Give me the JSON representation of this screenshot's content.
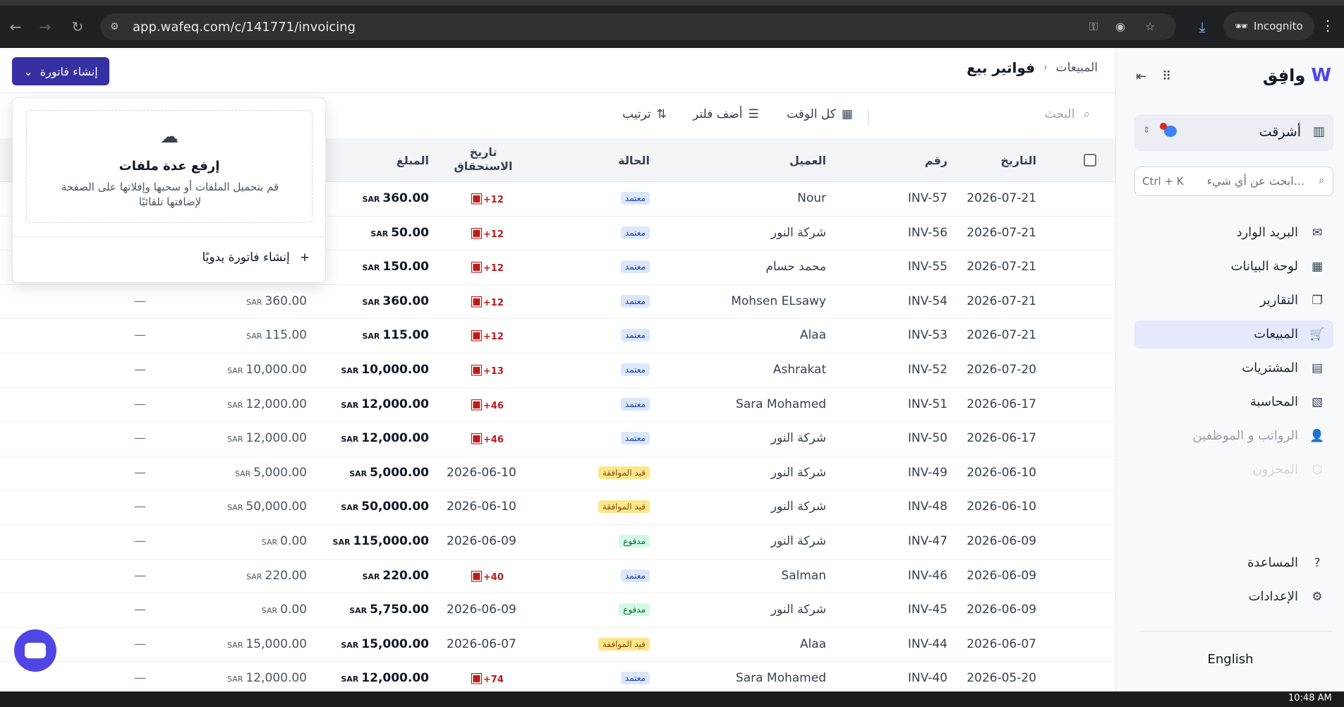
{
  "browser": {
    "url": "app.wafeq.com/c/141771/invoicing",
    "profile_label": "Incognito"
  },
  "sidebar": {
    "logo_text": "وافِق",
    "org_name": "أشرقت",
    "search_placeholder": "ابحث عن أي شيء...",
    "search_shortcut": "Ctrl + K",
    "items": [
      {
        "label": "البريد الوارد",
        "icon": "inbox-icon"
      },
      {
        "label": "لوحة البيانات",
        "icon": "dashboard-icon"
      },
      {
        "label": "التقارير",
        "icon": "reports-icon"
      },
      {
        "label": "المبيعات",
        "icon": "cart-icon"
      },
      {
        "label": "المشتريات",
        "icon": "purchases-icon"
      },
      {
        "label": "المحاسبة",
        "icon": "accounting-icon"
      },
      {
        "label": "الرواتب و الموظفين",
        "icon": "users-icon"
      },
      {
        "label": "المخزون",
        "icon": "box-icon"
      }
    ],
    "bottom_items": [
      {
        "label": "المساعدة",
        "icon": "help-icon"
      },
      {
        "label": "الإعدادات",
        "icon": "gear-icon"
      }
    ],
    "language": "English"
  },
  "header": {
    "breadcrumb_parent": "المبيعات",
    "title": "فواتير بيع",
    "create_button": "إنشاء فاتورة"
  },
  "toolbar": {
    "search_placeholder": "البحث",
    "time_filter": "كل الوقت",
    "add_filter": "أضف فلتر",
    "sort": "ترتيب"
  },
  "popover": {
    "upload_title": "إرفع عدة ملفات",
    "upload_desc": "قم بتحميل الملفات أو سحبها وإفلاتها على الصفحة لإضافتها تلقائيًا",
    "manual_create": "إنشاء فاتورة يدويًا"
  },
  "table": {
    "columns": {
      "date": "التاريخ",
      "number": "رقم",
      "customer": "العميل",
      "status": "الحالة",
      "due_date": "تاريخ الاستحقاق",
      "amount": "المبلغ"
    },
    "currency": "SAR",
    "rows": [
      {
        "date": "2026-07-21",
        "number": "INV-57",
        "customer": "Nour",
        "status": "معتمد",
        "due": "+12",
        "amount": "360.00",
        "balance": "",
        "extra": ""
      },
      {
        "date": "2026-07-21",
        "number": "INV-56",
        "customer": "شركة النور",
        "status": "معتمد",
        "due": "+12",
        "amount": "50.00",
        "balance": "",
        "extra": ""
      },
      {
        "date": "2026-07-21",
        "number": "INV-55",
        "customer": "محمد حسام",
        "status": "معتمد",
        "due": "+12",
        "amount": "150.00",
        "balance": "",
        "extra": ""
      },
      {
        "date": "2026-07-21",
        "number": "INV-54",
        "customer": "Mohsen ELsawy",
        "status": "معتمد",
        "due": "+12",
        "amount": "360.00",
        "balance": "360.00",
        "extra": "—"
      },
      {
        "date": "2026-07-21",
        "number": "INV-53",
        "customer": "Alaa",
        "status": "معتمد",
        "due": "+12",
        "amount": "115.00",
        "balance": "115.00",
        "extra": "—"
      },
      {
        "date": "2026-07-20",
        "number": "INV-52",
        "customer": "Ashrakat",
        "status": "معتمد",
        "due": "+13",
        "amount": "10,000.00",
        "balance": "10,000.00",
        "extra": "—"
      },
      {
        "date": "2026-06-17",
        "number": "INV-51",
        "customer": "Sara Mohamed",
        "status": "معتمد",
        "due": "+46",
        "amount": "12,000.00",
        "balance": "12,000.00",
        "extra": "—"
      },
      {
        "date": "2026-06-17",
        "number": "INV-50",
        "customer": "شركة النور",
        "status": "معتمد",
        "due": "+46",
        "amount": "12,000.00",
        "balance": "12,000.00",
        "extra": "—"
      },
      {
        "date": "2026-06-10",
        "number": "INV-49",
        "customer": "شركة النور",
        "status": "قيد الموافقة",
        "due_text": "2026-06-10",
        "amount": "5,000.00",
        "balance": "5,000.00",
        "extra": "—"
      },
      {
        "date": "2026-06-10",
        "number": "INV-48",
        "customer": "شركة النور",
        "status": "قيد الموافقة",
        "due_text": "2026-06-10",
        "amount": "50,000.00",
        "balance": "50,000.00",
        "extra": "—"
      },
      {
        "date": "2026-06-09",
        "number": "INV-47",
        "customer": "شركة النور",
        "status": "مدفوع",
        "due_text": "2026-06-09",
        "amount": "115,000.00",
        "balance": "0.00",
        "extra": "—"
      },
      {
        "date": "2026-06-09",
        "number": "INV-46",
        "customer": "Salman",
        "status": "معتمد",
        "due": "+40",
        "amount": "220.00",
        "balance": "220.00",
        "extra": "—"
      },
      {
        "date": "2026-06-09",
        "number": "INV-45",
        "customer": "شركة النور",
        "status": "مدفوع",
        "due_text": "2026-06-09",
        "amount": "5,750.00",
        "balance": "0.00",
        "extra": "—"
      },
      {
        "date": "2026-06-07",
        "number": "INV-44",
        "customer": "Alaa",
        "status": "قيد الموافقة",
        "due_text": "2026-06-07",
        "amount": "15,000.00",
        "balance": "15,000.00",
        "extra": "—"
      },
      {
        "date": "2026-05-20",
        "number": "INV-40",
        "customer": "Sara Mohamed",
        "status": "معتمد",
        "due": "+74",
        "amount": "12,000.00",
        "balance": "12,000.00",
        "extra": "—"
      }
    ]
  },
  "status_colors": {
    "معتمد": {
      "bg": "#dbe7fb",
      "fg": "#1e40af"
    },
    "قيد الموافقة": {
      "bg": "#fde68a",
      "fg": "#854d0e"
    },
    "مدفوع": {
      "bg": "#d1fae5",
      "fg": "#166534"
    }
  },
  "taskbar": {
    "clock": "10:48 AM"
  }
}
